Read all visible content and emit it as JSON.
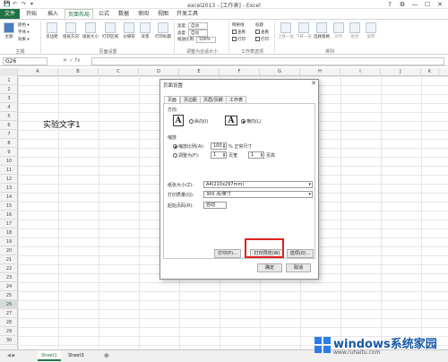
{
  "titlebar": {
    "title": "excel2013 - [工作表] - Excel",
    "quick_access": [
      "💾",
      "↶",
      "↷",
      "▾"
    ],
    "window_controls": [
      "?",
      "⧉",
      "—",
      "☐",
      "✕"
    ]
  },
  "tabs": [
    {
      "label": "文件"
    },
    {
      "label": "开始"
    },
    {
      "label": "插入"
    },
    {
      "label": "页面布局"
    },
    {
      "label": "公式"
    },
    {
      "label": "数据"
    },
    {
      "label": "审阅"
    },
    {
      "label": "视图"
    },
    {
      "label": "开发工具"
    }
  ],
  "ribbon": {
    "theme_group": {
      "label": "主题",
      "btn": "主题",
      "colors": "颜色 ▾",
      "fonts": "字体 ▾",
      "effects": "效果 ▾"
    },
    "page_setup_group": {
      "label": "页面设置",
      "buttons": [
        "页边距",
        "纸张方向",
        "纸张大小",
        "打印区域",
        "分隔符",
        "背景",
        "打印标题"
      ]
    },
    "scale_group": {
      "label": "调整为合适大小",
      "width_label": "宽度:",
      "width_val": "自动",
      "height_label": "高度:",
      "height_val": "自动",
      "scale_label": "缩放比例:",
      "scale_val": "100%"
    },
    "sheet_opts_group": {
      "label": "工作表选项",
      "gridlines": "网格线",
      "headings": "标题",
      "view": "查看",
      "print": "打印"
    },
    "arrange_group": {
      "label": "排列",
      "buttons": [
        "上移一层",
        "下移一层",
        "选择窗格",
        "对齐",
        "组合",
        "旋转"
      ]
    }
  },
  "formula_bar": {
    "namebox": "G26",
    "fx": "✕ ✓ fx",
    "value": ""
  },
  "columns": [
    "A",
    "B",
    "C",
    "D",
    "E",
    "F",
    "G",
    "H",
    "I",
    "J",
    "K",
    "L"
  ],
  "rows": [
    "1",
    "2",
    "3",
    "4",
    "5",
    "6",
    "7",
    "8",
    "9",
    "10",
    "11",
    "12",
    "13",
    "14",
    "15",
    "16",
    "17",
    "18",
    "19",
    "20",
    "21",
    "22",
    "23",
    "24",
    "25",
    "26",
    "27",
    "28",
    "29",
    "30"
  ],
  "active_row": "26",
  "cell_text": "实验文字1",
  "sheets": [
    "Sheet1",
    "Sheet3"
  ],
  "sheet_add": "⊕",
  "dialog": {
    "title": "页面设置",
    "close": "✕",
    "tabs": [
      "页面",
      "页边距",
      "页眉/页脚",
      "工作表"
    ],
    "orientation_label": "方向",
    "portrait": "纵向(I)",
    "landscape": "横向(L)",
    "scaling_label": "缩放",
    "adjust_to": "缩放比例(A):",
    "adjust_val": "100",
    "adjust_unit": "% 正常尺寸",
    "fit_to": "调整为(F):",
    "fit_pages_wide": "1",
    "pages_wide_unit": "页宽",
    "fit_pages_tall": "1",
    "pages_tall_unit": "页高",
    "paper_size_label": "纸张大小(Z):",
    "paper_size_val": "A4(210x297mm)",
    "print_quality_label": "打印质量(Q):",
    "print_quality_val": "300 点/英寸",
    "first_page_label": "起始页码(R):",
    "first_page_val": "自动",
    "print_btn": "打印(P)...",
    "preview_btn": "打印预览(W)",
    "options_btn": "选项(O)...",
    "ok_btn": "确定",
    "cancel_btn": "取消"
  },
  "watermark": {
    "main": "windows系统家园",
    "sub": "www.ruhaitu.com"
  },
  "colors": {
    "excel_green": "#217346",
    "highlight": "#dd2222"
  }
}
